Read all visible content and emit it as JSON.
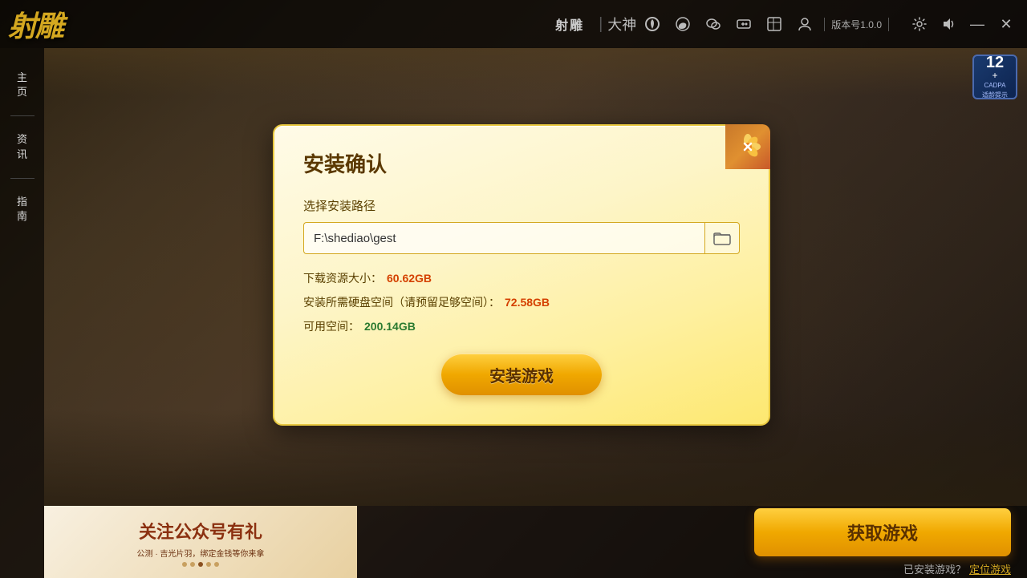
{
  "app": {
    "title": "射雕",
    "version": "版本号1.0.0"
  },
  "topbar": {
    "game_name": "射雕",
    "divider": "|",
    "nav_items": [
      "大神",
      "⊕",
      "◎",
      "✉",
      "♟",
      "▦",
      "⊙"
    ],
    "settings_icon": "⚙",
    "sound_icon": "🔊",
    "minimize_icon": "—",
    "close_icon": "✕"
  },
  "sidebar": {
    "items": [
      {
        "label": "主\n页",
        "key": "home"
      },
      {
        "divider": true
      },
      {
        "label": "资\n讯",
        "key": "news"
      },
      {
        "divider": true
      },
      {
        "label": "指\n南",
        "key": "guide"
      }
    ]
  },
  "age_badge": {
    "number": "12",
    "plus": "+",
    "line1": "CADPA",
    "line2": "适龄提示"
  },
  "dialog": {
    "title": "安装确认",
    "path_label": "选择安装路径",
    "path_value": "F:\\shediao\\gest",
    "path_placeholder": "F:\\shediao\\gest",
    "download_size_label": "下载资源大小：",
    "download_size_value": "60.62GB",
    "disk_label": "安装所需硬盘空间（请预留足够空间）：",
    "disk_value": "72.58GB",
    "available_label": "可用空间：",
    "available_value": "200.14GB",
    "install_btn": "安装游戏",
    "close_icon": "✕"
  },
  "bottom": {
    "banner_title": "关注公众号有礼",
    "banner_sub": "公测 · 吉光片羽，绑定金钱等你来拿",
    "banner_dots": [
      false,
      false,
      true,
      false,
      false
    ],
    "get_game_btn": "获取游戏",
    "installed_text": "已安装游戏？",
    "locate_text": "定位游戏"
  }
}
